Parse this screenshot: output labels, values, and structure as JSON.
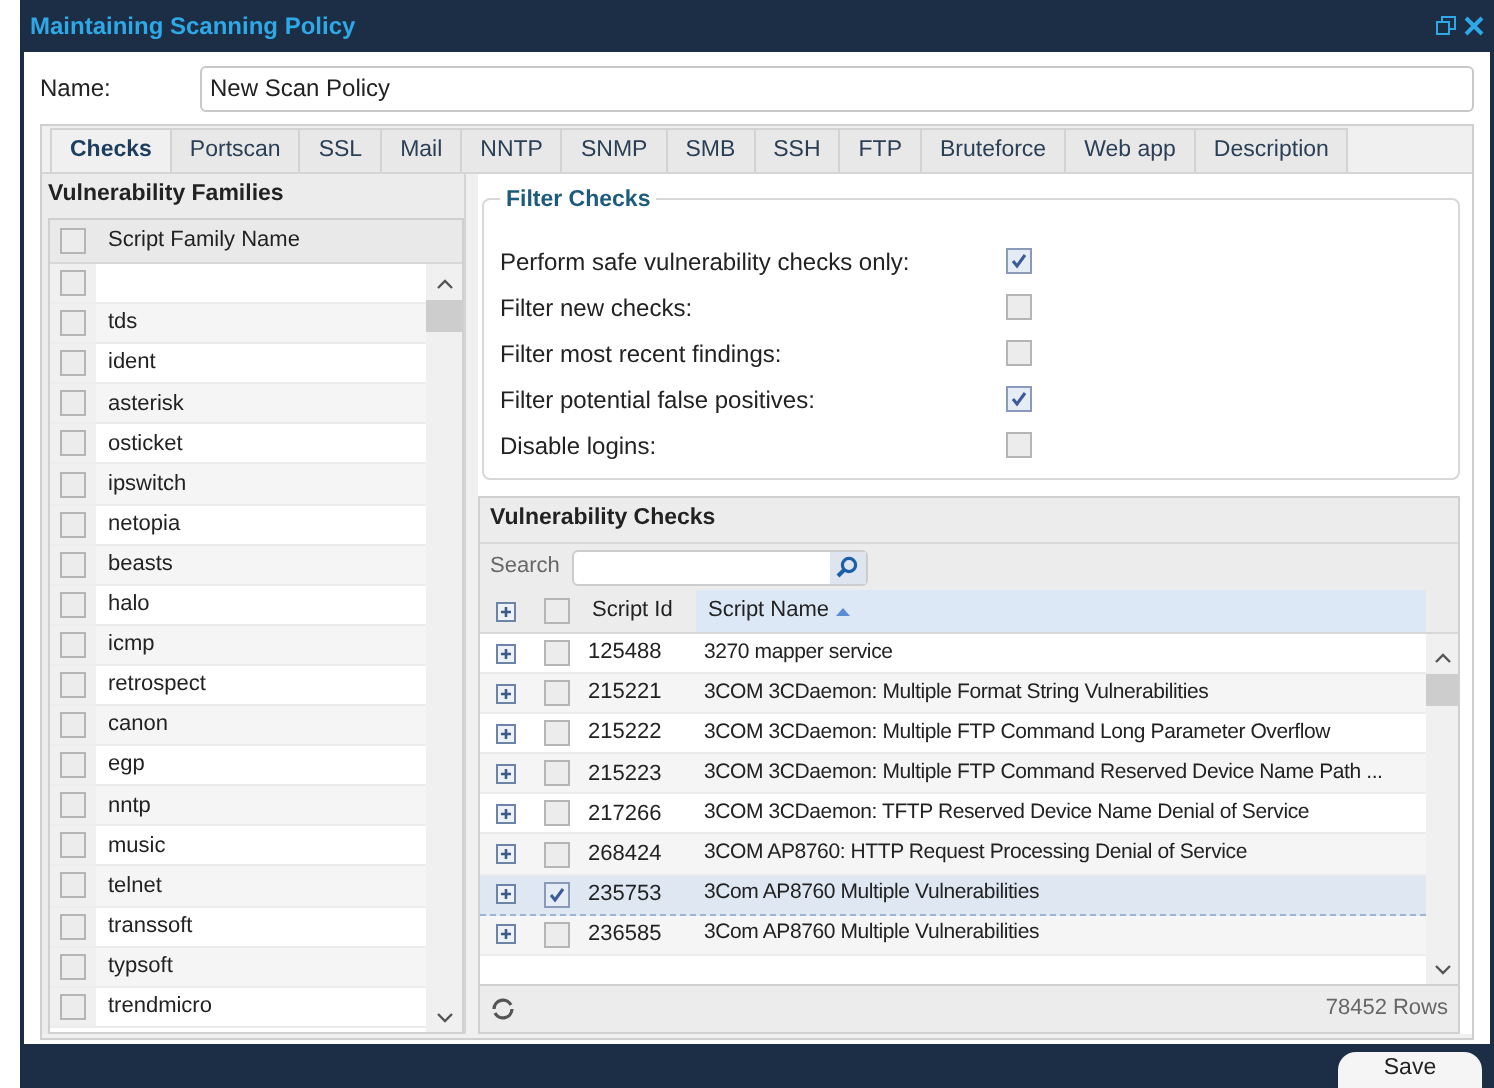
{
  "window": {
    "title": "Maintaining Scanning Policy"
  },
  "name_field": {
    "label": "Name:",
    "value": "New Scan Policy"
  },
  "tabs": [
    {
      "label": "Checks",
      "selected": true
    },
    {
      "label": "Portscan",
      "selected": false
    },
    {
      "label": "SSL",
      "selected": false
    },
    {
      "label": "Mail",
      "selected": false
    },
    {
      "label": "NNTP",
      "selected": false
    },
    {
      "label": "SNMP",
      "selected": false
    },
    {
      "label": "SMB",
      "selected": false
    },
    {
      "label": "SSH",
      "selected": false
    },
    {
      "label": "FTP",
      "selected": false
    },
    {
      "label": "Bruteforce",
      "selected": false
    },
    {
      "label": "Web app",
      "selected": false
    },
    {
      "label": "Description",
      "selected": false
    }
  ],
  "families": {
    "title": "Vulnerability Families",
    "header_checked": false,
    "column": "Script Family Name",
    "rows": [
      {
        "name": "",
        "checked": false
      },
      {
        "name": "tds",
        "checked": false
      },
      {
        "name": "ident",
        "checked": false
      },
      {
        "name": "asterisk",
        "checked": false
      },
      {
        "name": "osticket",
        "checked": false
      },
      {
        "name": "ipswitch",
        "checked": false
      },
      {
        "name": "netopia",
        "checked": false
      },
      {
        "name": "beasts",
        "checked": false
      },
      {
        "name": "halo",
        "checked": false
      },
      {
        "name": "icmp",
        "checked": false
      },
      {
        "name": "retrospect",
        "checked": false
      },
      {
        "name": "canon",
        "checked": false
      },
      {
        "name": "egp",
        "checked": false
      },
      {
        "name": "nntp",
        "checked": false
      },
      {
        "name": "music",
        "checked": false
      },
      {
        "name": "telnet",
        "checked": false
      },
      {
        "name": "transsoft",
        "checked": false
      },
      {
        "name": "typsoft",
        "checked": false
      },
      {
        "name": "trendmicro",
        "checked": false
      }
    ]
  },
  "filter_checks": {
    "title": "Filter Checks",
    "options": [
      {
        "label": "Perform safe vulnerability checks only:",
        "checked": true
      },
      {
        "label": "Filter new checks:",
        "checked": false
      },
      {
        "label": "Filter most recent findings:",
        "checked": false
      },
      {
        "label": "Filter potential false positives:",
        "checked": true
      },
      {
        "label": "Disable logins:",
        "checked": false
      }
    ]
  },
  "checks": {
    "title": "Vulnerability Checks",
    "search_label": "Search",
    "header_checked": false,
    "columns": [
      "Script Id",
      "Script Name"
    ],
    "rows": [
      {
        "id": "125488",
        "name": "3270 mapper service",
        "checked": false,
        "selected": false
      },
      {
        "id": "215221",
        "name": "3COM 3CDaemon: Multiple Format String Vulnerabilities",
        "checked": false,
        "selected": false
      },
      {
        "id": "215222",
        "name": "3COM 3CDaemon: Multiple FTP Command Long Parameter Overflow",
        "checked": false,
        "selected": false
      },
      {
        "id": "215223",
        "name": "3COM 3CDaemon: Multiple FTP Command Reserved Device Name Path ...",
        "checked": false,
        "selected": false
      },
      {
        "id": "217266",
        "name": "3COM 3CDaemon: TFTP Reserved Device Name Denial of Service",
        "checked": false,
        "selected": false
      },
      {
        "id": "268424",
        "name": "3COM AP8760: HTTP Request Processing Denial of Service",
        "checked": false,
        "selected": false
      },
      {
        "id": "235753",
        "name": "3Com AP8760 Multiple Vulnerabilities",
        "checked": true,
        "selected": true
      },
      {
        "id": "236585",
        "name": "3Com AP8760 Multiple Vulnerabilities",
        "checked": false,
        "selected": false
      }
    ],
    "row_count": "78452 Rows"
  },
  "save_button": "Save"
}
